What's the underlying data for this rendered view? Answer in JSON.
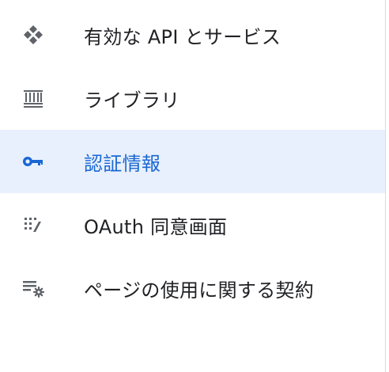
{
  "sidebar": {
    "items": [
      {
        "label": "有効な API とサービス",
        "icon": "api-diamond-icon",
        "active": false
      },
      {
        "label": "ライブラリ",
        "icon": "library-icon",
        "active": false
      },
      {
        "label": "認証情報",
        "icon": "key-icon",
        "active": true
      },
      {
        "label": "OAuth 同意画面",
        "icon": "oauth-consent-icon",
        "active": false
      },
      {
        "label": "ページの使用に関する契約",
        "icon": "page-agreement-settings-icon",
        "active": false
      }
    ]
  },
  "colors": {
    "active_bg": "#e8f0fe",
    "active_text": "#1967d2",
    "text": "#202124",
    "icon": "#5f6368"
  }
}
